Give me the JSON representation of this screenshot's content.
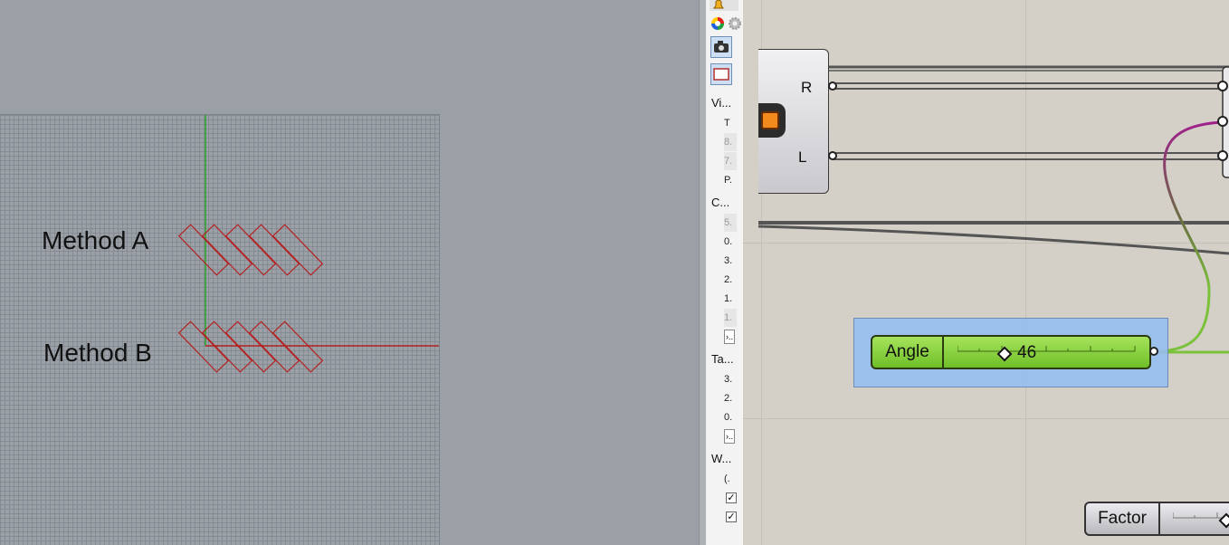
{
  "viewport": {
    "labels": [
      "Method A",
      "Method B"
    ]
  },
  "panel": {
    "icons": [
      "bell-icon",
      "color-wheel-icon",
      "gear-icon",
      "camera-icon",
      "rectangle-icon"
    ],
    "sections": [
      "Vi...",
      "C...",
      "Ta...",
      "W..."
    ],
    "view_rows": [
      "T",
      "8.",
      "7.",
      "P."
    ],
    "c_rows": [
      "5.",
      "0.",
      "3.",
      "2.",
      "1.",
      "1."
    ],
    "ta_rows": [
      "3.",
      "2.",
      "0."
    ],
    "w_rows": [
      "(."
    ],
    "button_glyph": "›..",
    "check_glyph": "✓"
  },
  "canvas": {
    "component": {
      "ports": [
        "R",
        "L"
      ]
    },
    "angle_slider": {
      "name": "Angle",
      "value": "46"
    },
    "factor_slider": {
      "name": "Factor"
    },
    "colors": {
      "wire": "#555555",
      "wire_magenta": "#a0208c",
      "wire_green": "#7bc23a",
      "group": "#96bef0",
      "slider_green": "#8ed04a"
    }
  }
}
